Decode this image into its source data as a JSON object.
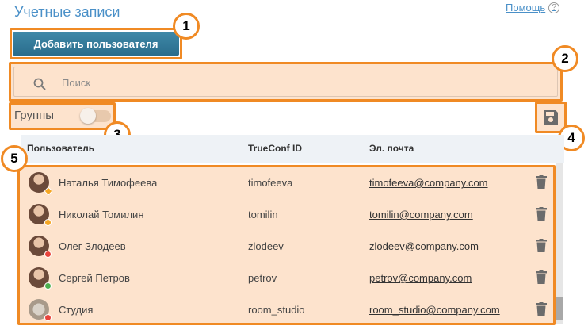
{
  "header": {
    "title": "Учетные записи",
    "help_label": "Помощь",
    "help_icon": "?"
  },
  "toolbar": {
    "add_user_label": "Добавить пользователя"
  },
  "search": {
    "placeholder": "Поиск",
    "value": ""
  },
  "groups": {
    "label": "Группы",
    "toggle_on": false
  },
  "callouts": [
    "1",
    "2",
    "3",
    "4",
    "5"
  ],
  "table": {
    "columns": [
      "Пользователь",
      "TrueConf ID",
      "Эл. почта"
    ],
    "rows": [
      {
        "name": "Наталья Тимофеева",
        "id": "timofeeva",
        "email": "timofeeva@company.com",
        "status": "star"
      },
      {
        "name": "Николай Томилин",
        "id": "tomilin",
        "email": "tomilin@company.com",
        "status": "away"
      },
      {
        "name": "Олег Злодеев",
        "id": "zlodeev",
        "email": "zlodeev@company.com",
        "status": "offline"
      },
      {
        "name": "Сергей Петров",
        "id": "petrov",
        "email": "petrov@company.com",
        "status": "online"
      },
      {
        "name": "Студия",
        "id": "room_studio",
        "email": "room_studio@company.com",
        "status": "offline"
      }
    ]
  },
  "colors": {
    "accent_blue": "#4a90c8",
    "highlight_orange": "#f08a24",
    "highlight_fill": "#fde3cd",
    "status_online": "#4caf50",
    "status_away": "#f5a623",
    "status_offline": "#e8453c"
  },
  "icons": {
    "search": "search-icon",
    "save": "save-icon",
    "delete": "trash-icon",
    "help": "help-icon"
  }
}
